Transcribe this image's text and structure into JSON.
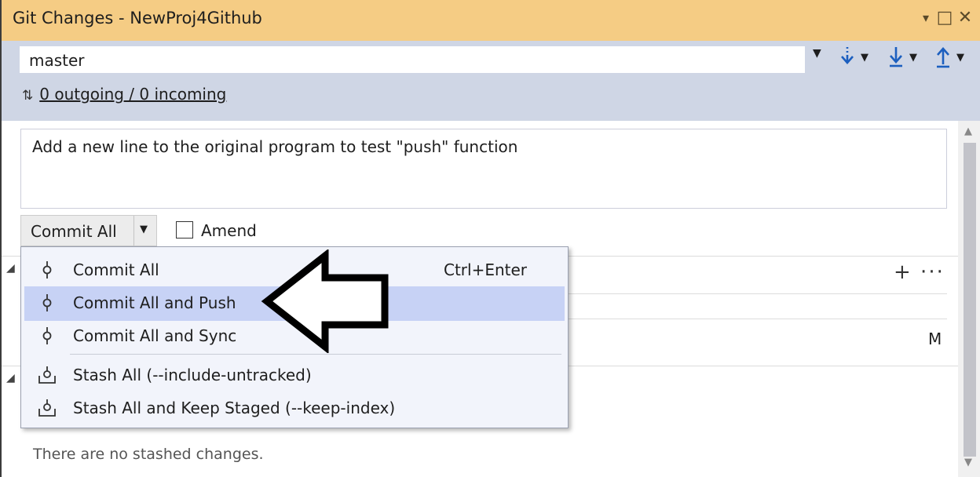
{
  "window": {
    "title": "Git Changes - NewProj4Github",
    "buttons": {
      "dropdown": "▾",
      "maximize": "□",
      "close": "✕"
    }
  },
  "branch": {
    "name": "master",
    "sync_arrows": "⇅",
    "sync_text": "0 outgoing / 0 incoming"
  },
  "commit": {
    "message": "Add a new line to the original program to test \"push\" function",
    "button_label": "Commit All",
    "amend_label": "Amend"
  },
  "changes": {
    "actions": "+ ···",
    "file_status": "M"
  },
  "stashes": {
    "empty_text": "There are no stashed changes."
  },
  "menu": {
    "items": [
      {
        "label": "Commit All",
        "shortcut": "Ctrl+Enter",
        "icon": "commit-icon",
        "highlighted": false
      },
      {
        "label": "Commit All and Push",
        "shortcut": "",
        "icon": "commit-icon",
        "highlighted": true
      },
      {
        "label": "Commit All and Sync",
        "shortcut": "",
        "icon": "commit-icon",
        "highlighted": false
      },
      {
        "label": "Stash All (--include-untracked)",
        "shortcut": "",
        "icon": "stash-icon",
        "highlighted": false
      },
      {
        "label": "Stash All and Keep Staged (--keep-index)",
        "shortcut": "",
        "icon": "stash-icon",
        "highlighted": false
      }
    ]
  },
  "colors": {
    "title_bar": "#f5cc84",
    "branch_bar": "#cfd6e5",
    "menu_highlight": "#c7d2f5",
    "git_action_blue": "#1c5fbf"
  }
}
